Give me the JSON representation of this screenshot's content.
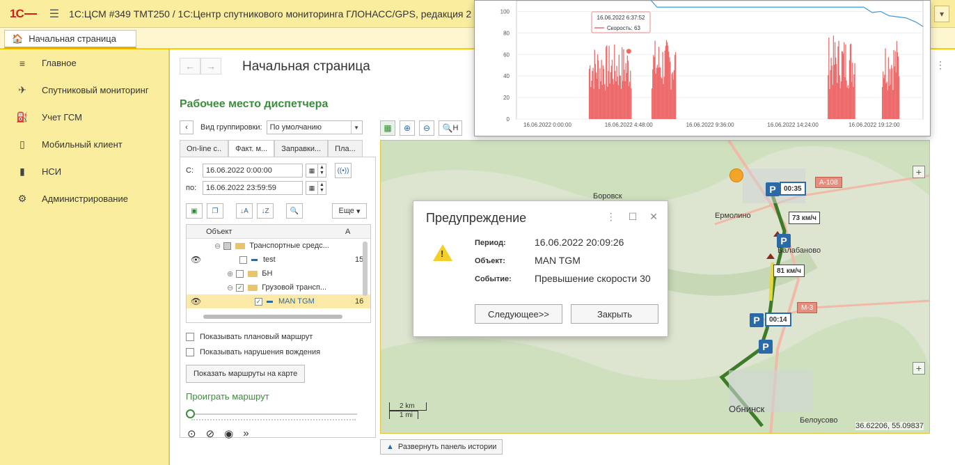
{
  "app": {
    "logo": "1С",
    "title": "1С:ЦСМ #349 ТМТ250 / 1С:Центр спутникового мониторинга ГЛОНАСС/GPS, редакция 2"
  },
  "tabs": {
    "home": "Начальная страница"
  },
  "sidebar": {
    "items": [
      {
        "label": "Главное",
        "icon": "menu-icon"
      },
      {
        "label": "Спутниковый мониторинг",
        "icon": "satellite-icon"
      },
      {
        "label": "Учет ГСМ",
        "icon": "fuel-icon"
      },
      {
        "label": "Мобильный клиент",
        "icon": "mobile-icon"
      },
      {
        "label": "НСИ",
        "icon": "books-icon"
      },
      {
        "label": "Администрирование",
        "icon": "gear-icon"
      }
    ]
  },
  "main": {
    "page_title": "Начальная страница",
    "section_title": "Рабочее место диспетчера",
    "group_label": "Вид группировки:",
    "group_value": "По умолчанию",
    "search_btn_label": "Н",
    "left_tabs": [
      "On-line с..",
      "Факт. м...",
      "Заправки...",
      "Пла..."
    ],
    "from_label": "С:",
    "from_value": "16.06.2022  0:00:00",
    "to_label": "по:",
    "to_value": "16.06.2022 23:59:59",
    "more_label": "Еще",
    "tree": {
      "col_object": "Объект",
      "col_other": "А",
      "rows": [
        {
          "label": "Транспортные средс...",
          "extra": ""
        },
        {
          "label": "test",
          "extra": "15"
        },
        {
          "label": "БН",
          "extra": ""
        },
        {
          "label": "Грузовой трансп...",
          "extra": ""
        },
        {
          "label": "MAN TGM",
          "extra": "16"
        }
      ]
    },
    "show_planned_route": "Показывать плановый маршрут",
    "show_violations": "Показывать нарушения вождения",
    "show_routes_btn": "Показать маршруты на карте",
    "play_route_title": "Проиграть маршрут",
    "expand_history": "Развернуть панель истории"
  },
  "map": {
    "coords": "36.62206, 55.09837",
    "places": [
      "Боровск",
      "Ермолино",
      "Балабаново",
      "Обнинск",
      "Белоусово"
    ],
    "roads": [
      "А-108",
      "М-3"
    ],
    "parking_times": [
      "00:35",
      "00:14"
    ],
    "speeds": [
      "73 км/ч",
      "81 км/ч"
    ],
    "scale_km": "2 km",
    "scale_mi": "1 mi"
  },
  "dialog": {
    "title": "Предупреждение",
    "period_label": "Период:",
    "period_value": "16.06.2022 20:09:26",
    "object_label": "Объект:",
    "object_value": "MAN TGM",
    "event_label": "Событие:",
    "event_value": "Превышение скорости 30",
    "next_btn": "Следующее>>",
    "close_btn": "Закрыть"
  },
  "chart_data": {
    "type": "area",
    "y_ticks": [
      0,
      20,
      40,
      60,
      80,
      100
    ],
    "x_ticks": [
      "16.06.2022 0:00:00",
      "16.06.2022 4:48:00",
      "16.06.2022 9:36:00",
      "16.06.2022 14:24:00",
      "16.06.2022 19:12:00"
    ],
    "tooltip": {
      "time": "16.06.2022 6:37:52",
      "series": "Скорость",
      "value": 63
    },
    "speed_bursts": [
      {
        "start_h": 4.3,
        "end_h": 6.8,
        "peak": 70
      },
      {
        "start_h": 8.0,
        "end_h": 9.4,
        "peak": 75
      },
      {
        "start_h": 18.4,
        "end_h": 20.0,
        "peak": 78
      },
      {
        "start_h": 21.6,
        "end_h": 22.6,
        "peak": 76
      }
    ],
    "colors": {
      "speed": "#ee6b6b",
      "line": "#3a9ad9"
    }
  }
}
